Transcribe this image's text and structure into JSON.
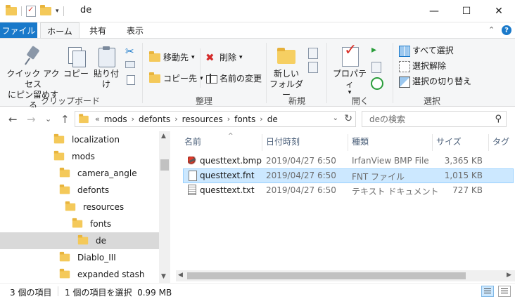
{
  "window": {
    "title": "de",
    "minimize_glyph": "—",
    "maximize_glyph": "☐",
    "close_glyph": "✕"
  },
  "qat": {
    "dropdown_glyph": "▾"
  },
  "tabs": {
    "file": "ファイル",
    "home": "ホーム",
    "share": "共有",
    "view": "表示",
    "collapse_glyph": "⌃",
    "help_glyph": "?"
  },
  "ribbon": {
    "clipboard": {
      "label": "クリップボード",
      "pin_quick_access": "クイック アクセス\nにピン留めする",
      "copy": "コピー",
      "paste": "貼り付け"
    },
    "organize": {
      "label": "整理",
      "move_to": "移動先",
      "copy_to": "コピー先",
      "delete": "削除",
      "rename": "名前の変更"
    },
    "new": {
      "label": "新規",
      "new_folder": "新しい\nフォルダー"
    },
    "open": {
      "label": "開く",
      "properties": "プロパティ"
    },
    "select": {
      "label": "選択",
      "select_all": "すべて選択",
      "select_none": "選択解除",
      "invert_selection": "選択の切り替え"
    },
    "drop_glyph": "▾"
  },
  "nav": {
    "back_glyph": "←",
    "forward_glyph": "→",
    "recent_glyph": "⌄",
    "up_glyph": "↑",
    "overflow": "«",
    "separator": "›",
    "breadcrumb": [
      "mods",
      "defonts",
      "resources",
      "fonts",
      "de"
    ],
    "dropdown_glyph": "⌄",
    "refresh_glyph": "↻",
    "search_placeholder": "deの検索",
    "search_glyph": "⚲"
  },
  "tree": {
    "items": [
      {
        "label": "localization"
      },
      {
        "label": "mods"
      },
      {
        "label": "camera_angle"
      },
      {
        "label": "defonts"
      },
      {
        "label": "resources"
      },
      {
        "label": "fonts"
      },
      {
        "label": "de"
      },
      {
        "label": "Diablo_III"
      },
      {
        "label": "expanded stash"
      }
    ],
    "scroll_up": "▲",
    "scroll_down": "▼"
  },
  "columns": {
    "name": "名前",
    "date": "日付時刻",
    "type": "種類",
    "size": "サイズ",
    "tags": "タグ",
    "sort_glyph": "^"
  },
  "files": [
    {
      "name": "questtext.bmp",
      "date": "2019/04/27 6:50",
      "type": "IrfanView BMP File",
      "size": "3,365 KB"
    },
    {
      "name": "questtext.fnt",
      "date": "2019/04/27 6:50",
      "type": "FNT ファイル",
      "size": "1,015 KB"
    },
    {
      "name": "questtext.txt",
      "date": "2019/04/27 6:50",
      "type": "テキスト ドキュメント",
      "size": "727 KB"
    }
  ],
  "hscroll": {
    "left": "◀",
    "right": "▶"
  },
  "status": {
    "item_count": "3 個の項目",
    "selection": "1 個の項目を選択  0.99 MB"
  }
}
